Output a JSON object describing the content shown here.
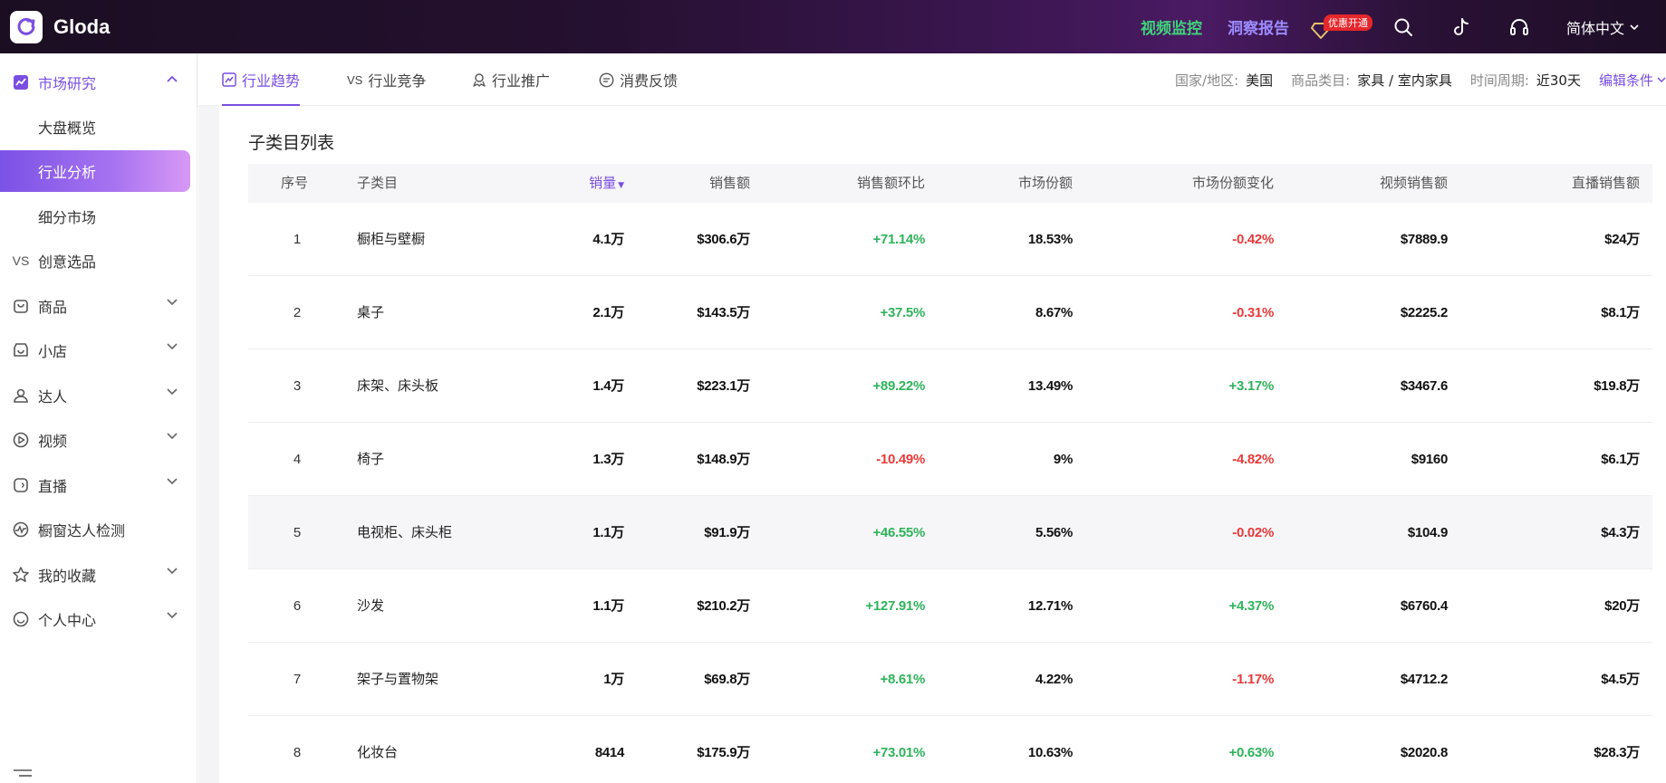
{
  "app": {
    "name": "Gloda"
  },
  "topbar": {
    "video_monitor": "视频监控",
    "insight_report": "洞察报告",
    "promo_badge": "优惠开通",
    "language": "简体中文"
  },
  "sidebar": {
    "items": [
      {
        "label": "市场研究",
        "icon": "chart-icon",
        "expanded": true
      },
      {
        "label": "大盘概览"
      },
      {
        "label": "行业分析",
        "active": true
      },
      {
        "label": "细分市场"
      },
      {
        "label": "创意选品",
        "icon_text": "VS"
      },
      {
        "label": "商品",
        "icon": "bag-icon"
      },
      {
        "label": "小店",
        "icon": "store-icon"
      },
      {
        "label": "达人",
        "icon": "user-icon"
      },
      {
        "label": "视频",
        "icon": "play-icon"
      },
      {
        "label": "直播",
        "icon": "live-icon"
      },
      {
        "label": "橱窗达人检测",
        "icon": "pulse-icon"
      },
      {
        "label": "我的收藏",
        "icon": "star-icon"
      },
      {
        "label": "个人中心",
        "icon": "smile-icon"
      }
    ]
  },
  "tabs": [
    {
      "label": "行业趋势",
      "active": true
    },
    {
      "label": "行业竞争",
      "icon_text": "VS"
    },
    {
      "label": "行业推广"
    },
    {
      "label": "消费反馈"
    }
  ],
  "filters": {
    "region_label": "国家/地区:",
    "region_value": "美国",
    "category_label": "商品类目:",
    "category_value": "家具 / 室内家具",
    "period_label": "时间周期:",
    "period_value": "近30天",
    "edit_label": "编辑条件"
  },
  "table": {
    "title": "子类目列表",
    "headers": {
      "index": "序号",
      "name": "子类目",
      "sales": "销量",
      "amount": "销售额",
      "mom": "销售额环比",
      "share": "市场份额",
      "share_change": "市场份额变化",
      "video_sales": "视频销售额",
      "live_sales": "直播销售额"
    },
    "rows": [
      {
        "index": "1",
        "name": "橱柜与壁橱",
        "sales": "4.1万",
        "amount": "$306.6万",
        "mom": "+71.14%",
        "share": "18.53%",
        "share_change": "-0.42%",
        "video_sales": "$7889.9",
        "live_sales": "$24万"
      },
      {
        "index": "2",
        "name": "桌子",
        "sales": "2.1万",
        "amount": "$143.5万",
        "mom": "+37.5%",
        "share": "8.67%",
        "share_change": "-0.31%",
        "video_sales": "$2225.2",
        "live_sales": "$8.1万"
      },
      {
        "index": "3",
        "name": "床架、床头板",
        "sales": "1.4万",
        "amount": "$223.1万",
        "mom": "+89.22%",
        "share": "13.49%",
        "share_change": "+3.17%",
        "video_sales": "$3467.6",
        "live_sales": "$19.8万"
      },
      {
        "index": "4",
        "name": "椅子",
        "sales": "1.3万",
        "amount": "$148.9万",
        "mom": "-10.49%",
        "share": "9%",
        "share_change": "-4.82%",
        "video_sales": "$9160",
        "live_sales": "$6.1万"
      },
      {
        "index": "5",
        "name": "电视柜、床头柜",
        "sales": "1.1万",
        "amount": "$91.9万",
        "mom": "+46.55%",
        "share": "5.56%",
        "share_change": "-0.02%",
        "video_sales": "$104.9",
        "live_sales": "$4.3万"
      },
      {
        "index": "6",
        "name": "沙发",
        "sales": "1.1万",
        "amount": "$210.2万",
        "mom": "+127.91%",
        "share": "12.71%",
        "share_change": "+4.37%",
        "video_sales": "$6760.4",
        "live_sales": "$20万"
      },
      {
        "index": "7",
        "name": "架子与置物架",
        "sales": "1万",
        "amount": "$69.8万",
        "mom": "+8.61%",
        "share": "4.22%",
        "share_change": "-1.17%",
        "video_sales": "$4712.2",
        "live_sales": "$4.5万"
      },
      {
        "index": "8",
        "name": "化妆台",
        "sales": "8414",
        "amount": "$175.9万",
        "mom": "+73.01%",
        "share": "10.63%",
        "share_change": "+0.63%",
        "video_sales": "$2020.8",
        "live_sales": "$28.3万"
      }
    ]
  },
  "colors": {
    "accent": "#7a4fe0",
    "positive": "#2fb35b",
    "negative": "#e83a3a"
  }
}
